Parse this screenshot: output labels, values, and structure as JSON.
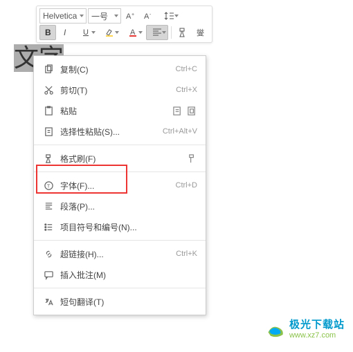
{
  "toolbar": {
    "font_name": "Helvetica",
    "font_size": "一号"
  },
  "document": {
    "text_part1": "文",
    "text_part2": "字"
  },
  "menu": {
    "copy": "复制(C)",
    "copy_sc": "Ctrl+C",
    "cut": "剪切(T)",
    "cut_sc": "Ctrl+X",
    "paste": "粘贴",
    "paste_special": "选择性粘贴(S)...",
    "paste_special_sc": "Ctrl+Alt+V",
    "format_painter": "格式刷(F)",
    "font": "字体(F)...",
    "font_sc": "Ctrl+D",
    "paragraph": "段落(P)...",
    "bullets": "项目符号和编号(N)...",
    "hyperlink": "超链接(H)...",
    "hyperlink_sc": "Ctrl+K",
    "comment": "插入批注(M)",
    "translate": "短句翻译(T)"
  },
  "watermark": {
    "cn": "极光下载站",
    "url": "www.xz7.com"
  }
}
